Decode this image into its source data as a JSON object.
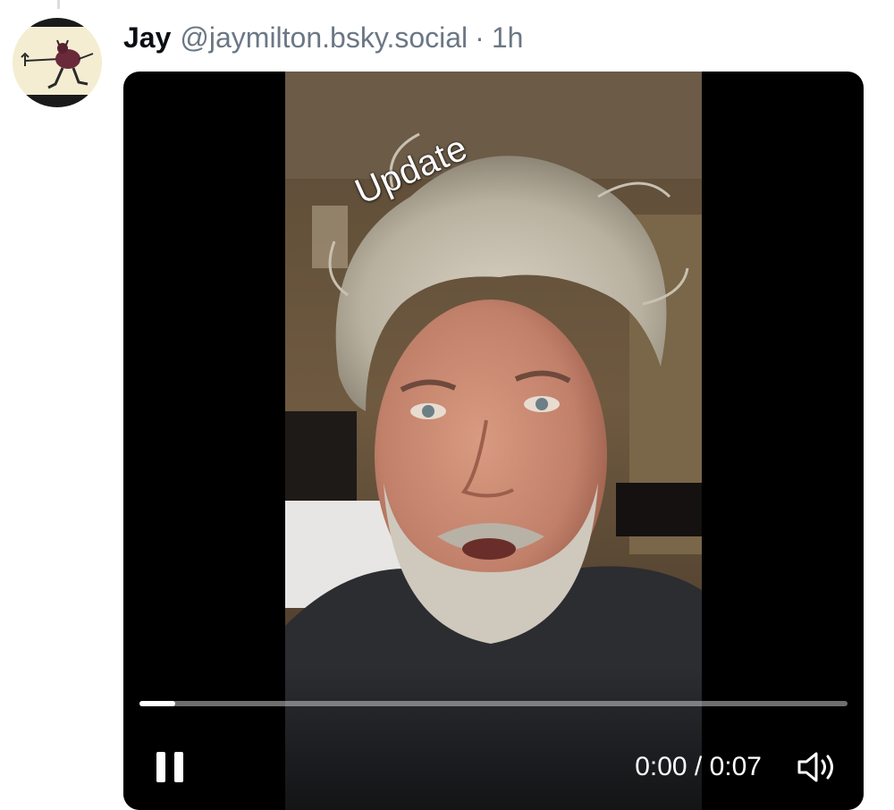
{
  "post": {
    "author": {
      "name": "Jay",
      "handle": "@jaymilton.bsky.social",
      "avatar_icon": "devil-with-trident-avatar"
    },
    "separator": "·",
    "time": "1h"
  },
  "video": {
    "overlay_caption": "Update",
    "current_time": "0:00",
    "duration": "0:07",
    "time_display": "0:00 / 0:07",
    "progress_fraction": 0.05,
    "state": "playing",
    "icons": {
      "play_pause": "pause-icon",
      "volume": "speaker-icon"
    }
  }
}
